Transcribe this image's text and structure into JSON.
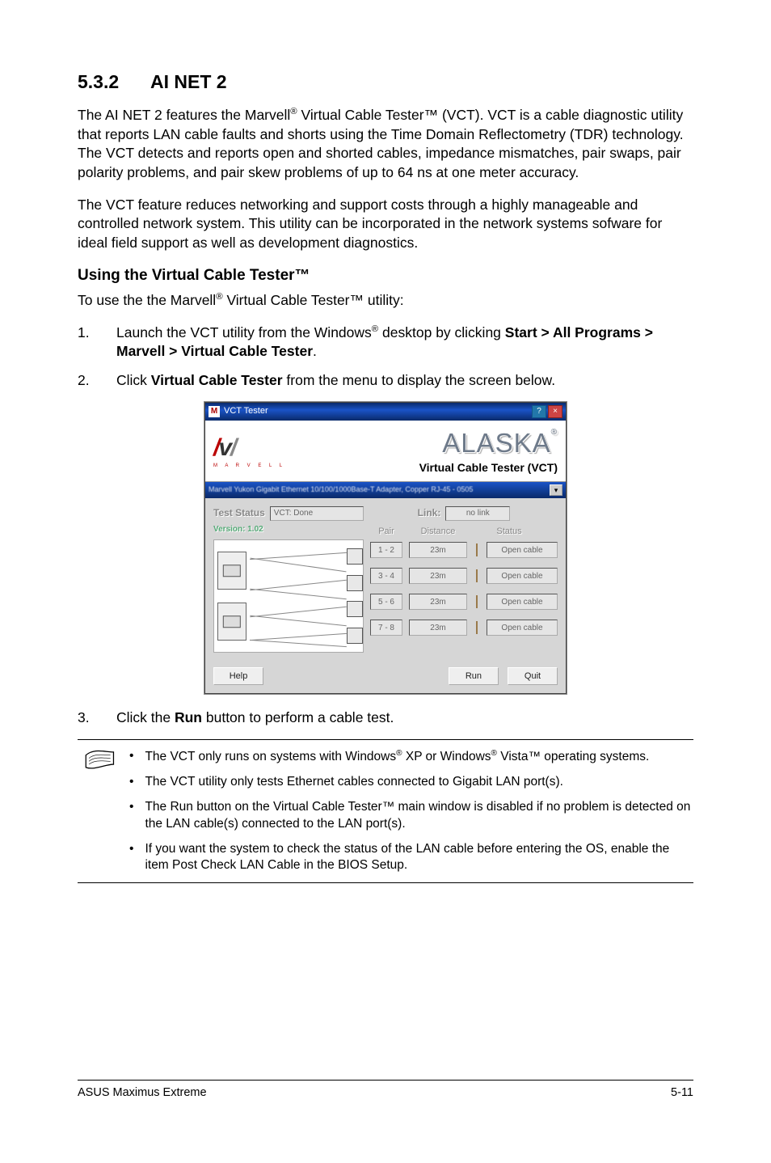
{
  "heading": {
    "num": "5.3.2",
    "title": "AI NET 2"
  },
  "paras": {
    "p1a": "The AI NET 2 features the Marvell",
    "p1b": " Virtual Cable Tester™ (VCT). VCT is a cable diagnostic utility that reports LAN cable faults and shorts using the Time Domain Reflectometry (TDR) technology. The VCT detects and reports open and shorted cables, impedance mismatches, pair swaps, pair polarity problems, and pair skew problems of up to 64 ns at one meter accuracy.",
    "p2": "The VCT feature reduces networking and support costs through a highly manageable and controlled network system. This utility can be incorporated in the network systems sofware for ideal field support as well as development diagnostics."
  },
  "subhead": "Using the Virtual Cable Tester™",
  "sub_intro_a": "To use the the Marvell",
  "sub_intro_b": " Virtual Cable Tester™ utility:",
  "steps": [
    {
      "num": "1.",
      "pre": "Launch the VCT utility from the Windows",
      "sup": "®",
      "mid": " desktop by clicking ",
      "bold": "Start > All Programs > Marvell > Virtual Cable Tester",
      "post": "."
    },
    {
      "num": "2.",
      "pre": "Click ",
      "bold": "Virtual Cable Tester",
      "post": " from the menu to display the screen below."
    },
    {
      "num": "3.",
      "pre": "Click the ",
      "bold": "Run",
      "post": " button to perform a cable test."
    }
  ],
  "screenshot": {
    "title": "VCT Tester",
    "marvell_text": "M A R V E L L",
    "alaska": "ALASKA",
    "vct_label": "Virtual Cable Tester (VCT)",
    "selector": "Marvell Yukon Gigabit Ethernet 10/100/1000Base-T Adapter, Copper RJ-45 - 0505",
    "test_status_label": "Test Status",
    "test_status_value": "VCT: Done",
    "version_label": "Version:",
    "version_value": "1.02",
    "link_label": "Link:",
    "link_value": "no link",
    "columns": {
      "pair": "Pair",
      "distance": "Distance",
      "status": "Status"
    },
    "rows": [
      {
        "pair": "1 - 2",
        "distance": "23m",
        "status": "Open cable"
      },
      {
        "pair": "3 - 4",
        "distance": "23m",
        "status": "Open cable"
      },
      {
        "pair": "5 - 6",
        "distance": "23m",
        "status": "Open cable"
      },
      {
        "pair": "7 - 8",
        "distance": "23m",
        "status": "Open cable"
      }
    ],
    "buttons": {
      "help": "Help",
      "run": "Run",
      "quit": "Quit"
    }
  },
  "notes": [
    {
      "pre": "The VCT only runs on systems with Windows",
      "sup1": "®",
      "mid": " XP or Windows",
      "sup2": "®",
      "post": " Vista™ operating systems."
    },
    {
      "text": "The VCT utility only tests Ethernet cables connected to Gigabit LAN port(s)."
    },
    {
      "text": "The Run button on the Virtual Cable Tester™ main window is disabled if no problem is detected on the LAN cable(s) connected to the LAN port(s)."
    },
    {
      "text": "If you want the system to check the status of the LAN cable before entering the OS, enable the item Post Check LAN Cable in the BIOS Setup."
    }
  ],
  "footer": {
    "left": "ASUS Maximus Extreme",
    "right": "5-11"
  },
  "reg": "®"
}
